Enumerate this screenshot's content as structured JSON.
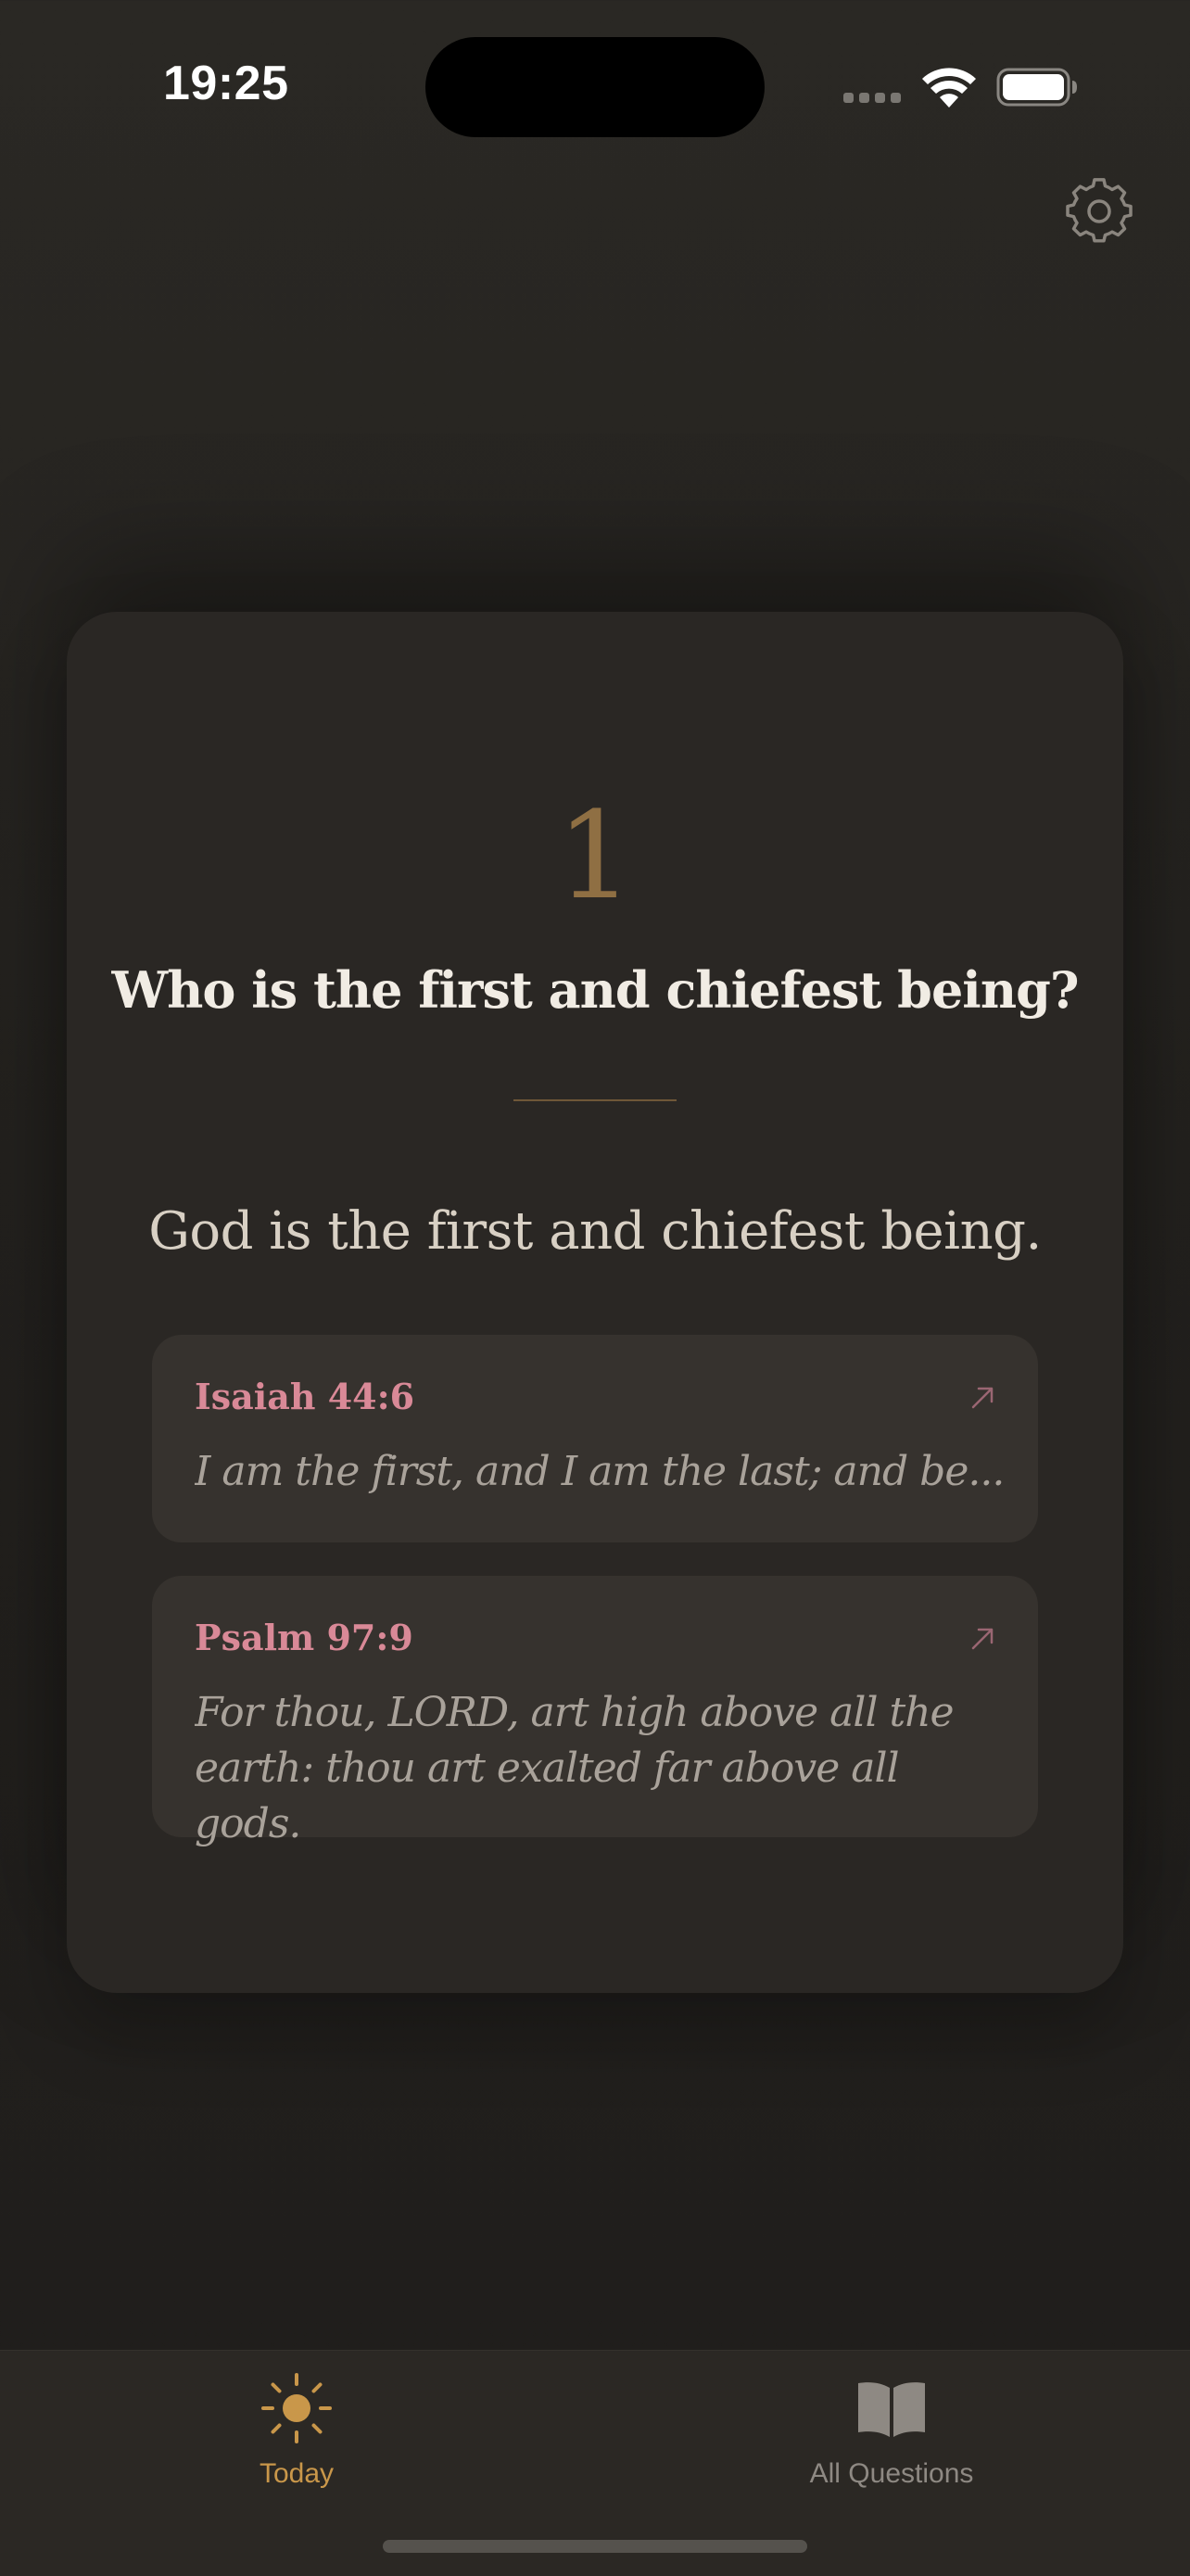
{
  "status_bar": {
    "time": "19:25"
  },
  "header": {
    "settings_icon": "gear-icon"
  },
  "question": {
    "number": "1",
    "text": "Who is the first and chiefest being?",
    "answer": "God is the first and chiefest being."
  },
  "references": [
    {
      "citation": "Isaiah 44:6",
      "text": "I am the first, and I am the last; and be...",
      "icon": "arrow-up-right-icon"
    },
    {
      "citation": "Psalm 97:9",
      "text": "For thou, LORD, art high above all the earth: thou art exalted far above all gods.",
      "icon": "arrow-up-right-icon"
    }
  ],
  "tabs": [
    {
      "label": "Today",
      "icon": "sun-icon",
      "selected": true
    },
    {
      "label": "All Questions",
      "icon": "book-icon",
      "selected": false
    }
  ],
  "colors": {
    "accent": "#c9974a",
    "reference_title": "#d98997",
    "question_number": "#8f6f43"
  }
}
